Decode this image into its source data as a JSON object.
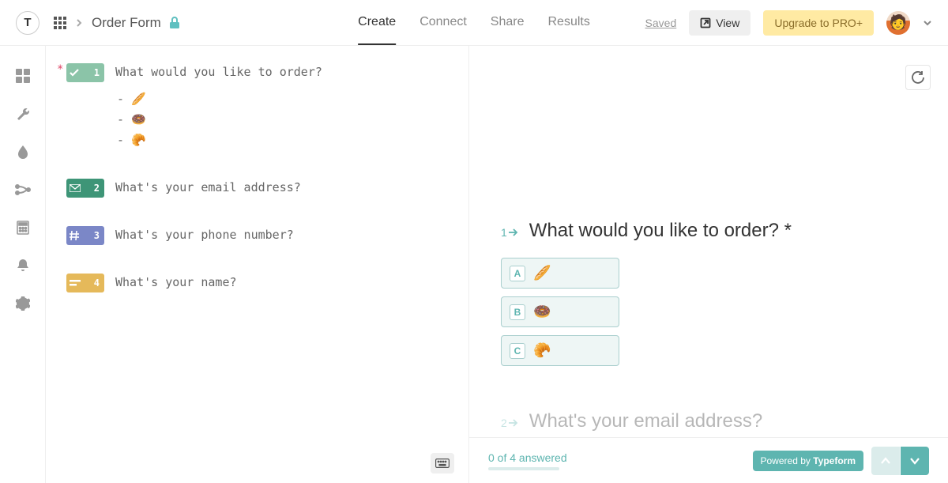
{
  "header": {
    "logo_letter": "T",
    "page_title": "Order Form",
    "tabs": {
      "create": "Create",
      "connect": "Connect",
      "share": "Share",
      "results": "Results"
    },
    "saved": "Saved",
    "view": "View",
    "upgrade": "Upgrade to PRO+"
  },
  "editor": {
    "questions": [
      {
        "num": "1",
        "text": "What would you like to order?",
        "required": true,
        "options": [
          "- 🥖",
          "- 🍩",
          "- 🥐"
        ]
      },
      {
        "num": "2",
        "text": "What's your email address?"
      },
      {
        "num": "3",
        "text": "What's your phone number?"
      },
      {
        "num": "4",
        "text": "What's your name?"
      }
    ]
  },
  "preview": {
    "q1": {
      "num": "1",
      "title": "What would you like to order? *",
      "choices": [
        {
          "key": "A",
          "emoji": "🥖"
        },
        {
          "key": "B",
          "emoji": "🍩"
        },
        {
          "key": "C",
          "emoji": "🥐"
        }
      ]
    },
    "q2": {
      "num": "2",
      "title": "What's your email address?"
    },
    "progress": "0 of 4 answered",
    "powered_prefix": "Powered by ",
    "powered_brand": "Typeform"
  }
}
